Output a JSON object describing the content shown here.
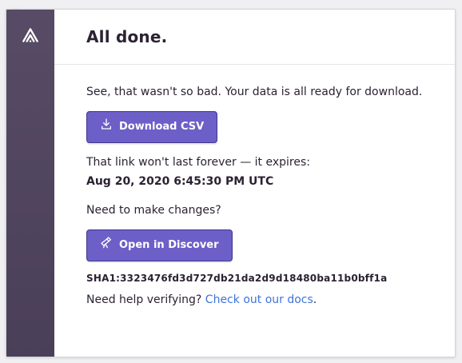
{
  "header": {
    "title": "All done."
  },
  "main": {
    "intro_text": "See, that wasn't so bad. Your data is all ready for download.",
    "download_button_label": "Download CSV",
    "expires_text": "That link won't last forever — it expires:",
    "expires_date": "Aug 20, 2020 6:45:30 PM UTC",
    "changes_text": "Need to make changes?",
    "discover_button_label": "Open in Discover",
    "sha_text": "SHA1:3323476fd3d727db21da2d9d18480ba11b0bff1a",
    "help_prefix": "Need help verifying?",
    "help_link_text": "Check out our docs",
    "help_suffix": "."
  },
  "icons": {
    "sidebar_logo": "sentry-logo-icon",
    "download": "download-icon",
    "discover": "telescope-icon"
  },
  "colors": {
    "sidebar": "#574b66",
    "accent": "#6c5fc7",
    "link": "#3d74db",
    "text": "#2b2233"
  }
}
